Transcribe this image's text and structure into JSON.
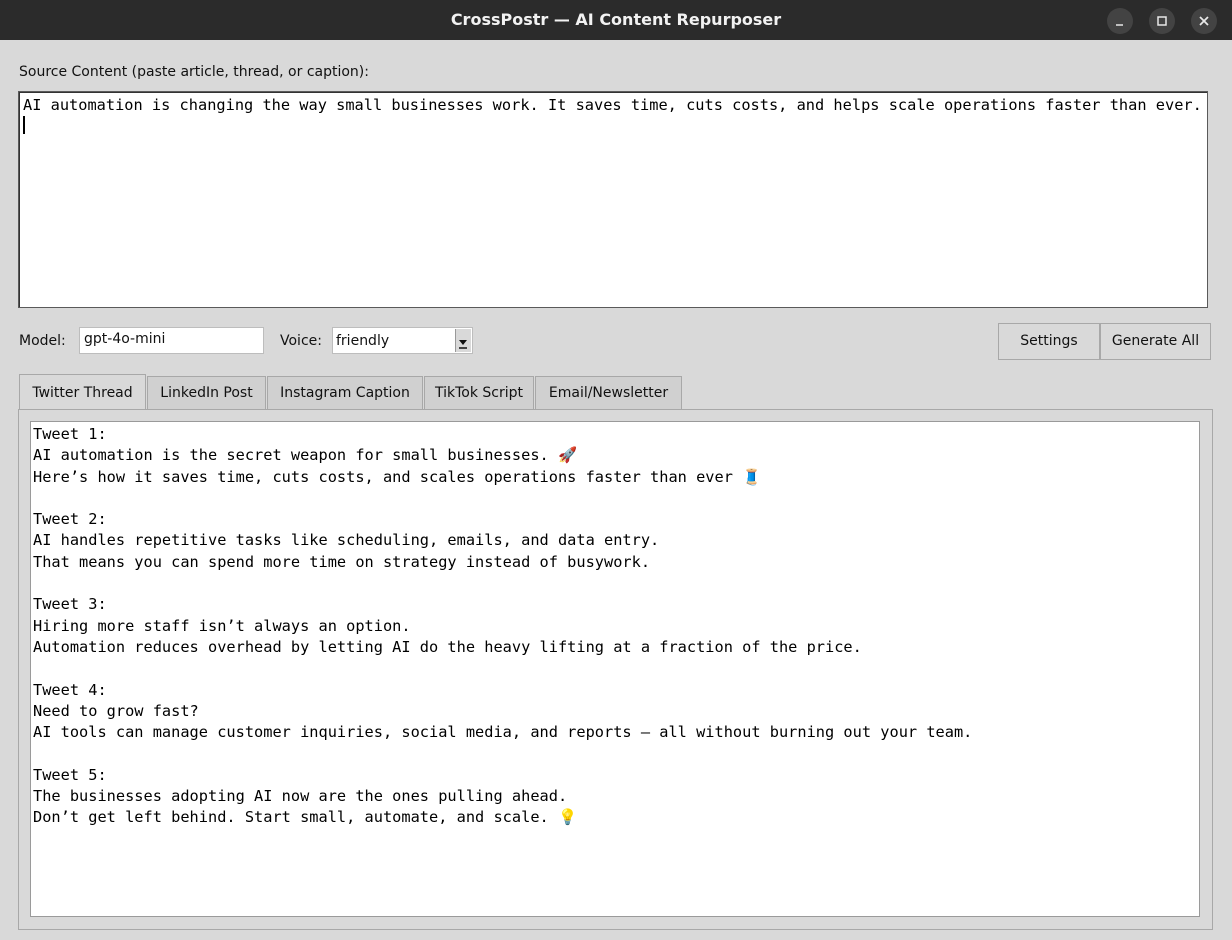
{
  "window": {
    "title": "CrossPostr — AI Content Repurposer",
    "min_glyph": "_",
    "max_glyph": "□",
    "close_glyph": "✕"
  },
  "source": {
    "label": "Source Content (paste article, thread, or caption):",
    "text": "AI automation is changing the way small businesses work. It saves time, cuts costs, and helps scale operations faster than ever."
  },
  "controls": {
    "model_label": "Model:",
    "model_value": "gpt-4o-mini",
    "voice_label": "Voice:",
    "voice_value": "friendly",
    "settings_label": "Settings",
    "generate_label": "Generate All"
  },
  "tabs": [
    {
      "label": "Twitter Thread",
      "active": true
    },
    {
      "label": "LinkedIn Post",
      "active": false
    },
    {
      "label": "Instagram Caption",
      "active": false
    },
    {
      "label": "TikTok Script",
      "active": false
    },
    {
      "label": "Email/Newsletter",
      "active": false
    }
  ],
  "output": {
    "text": "Tweet 1:\nAI automation is the secret weapon for small businesses. 🚀\nHere’s how it saves time, cuts costs, and scales operations faster than ever 🧵\n\nTweet 2:\nAI handles repetitive tasks like scheduling, emails, and data entry.\nThat means you can spend more time on strategy instead of busywork.\n\nTweet 3:\nHiring more staff isn’t always an option.\nAutomation reduces overhead by letting AI do the heavy lifting at a fraction of the price.\n\nTweet 4:\nNeed to grow fast?\nAI tools can manage customer inquiries, social media, and reports — all without burning out your team.\n\nTweet 5:\nThe businesses adopting AI now are the ones pulling ahead.\nDon’t get left behind. Start small, automate, and scale. 💡"
  }
}
